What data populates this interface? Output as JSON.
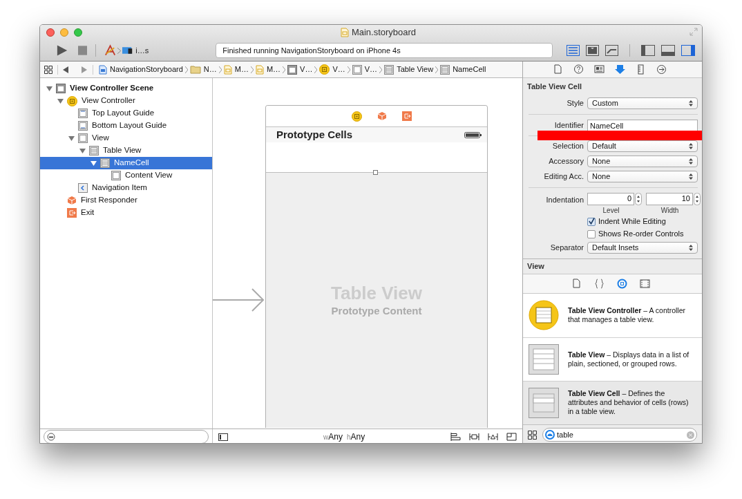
{
  "window": {
    "title": "Main.storyboard"
  },
  "toolbar": {
    "scheme": "i…s",
    "status": "Finished running NavigationStoryboard on iPhone 4s",
    "editor_modes": [
      {
        "selected": true
      },
      {
        "selected": false
      },
      {
        "selected": false
      }
    ],
    "panels": [
      {
        "selected": false
      },
      {
        "selected": false
      },
      {
        "selected": true
      }
    ]
  },
  "jump_bar": [
    {
      "label": "NavigationStoryboard",
      "kind": "project"
    },
    {
      "label": "N…",
      "kind": "folder"
    },
    {
      "label": "M…",
      "kind": "storyboard"
    },
    {
      "label": "M…",
      "kind": "storyboard"
    },
    {
      "label": "V…",
      "kind": "scene"
    },
    {
      "label": "V…",
      "kind": "controller"
    },
    {
      "label": "V…",
      "kind": "view"
    },
    {
      "label": "Table View",
      "kind": "table"
    },
    {
      "label": "NameCell",
      "kind": "table"
    }
  ],
  "outline": [
    {
      "label": "View Controller Scene",
      "kind": "scene",
      "expanded": true,
      "selected": false,
      "children": [
        {
          "label": "View Controller",
          "kind": "controller",
          "expanded": true,
          "selected": false,
          "children": [
            {
              "label": "Top Layout Guide",
              "kind": "guide-top",
              "selected": false
            },
            {
              "label": "Bottom Layout Guide",
              "kind": "guide-bottom",
              "selected": false
            },
            {
              "label": "View",
              "kind": "view",
              "expanded": true,
              "selected": false,
              "children": [
                {
                  "label": "Table View",
                  "kind": "table",
                  "expanded": true,
                  "selected": false,
                  "children": [
                    {
                      "label": "NameCell",
                      "kind": "table",
                      "expanded": true,
                      "selected": true,
                      "children": [
                        {
                          "label": "Content View",
                          "kind": "view",
                          "selected": false
                        }
                      ]
                    }
                  ]
                }
              ]
            },
            {
              "label": "Navigation Item",
              "kind": "nav-item",
              "selected": false
            }
          ]
        },
        {
          "label": "First Responder",
          "kind": "responder",
          "selected": false
        },
        {
          "label": "Exit",
          "kind": "exit",
          "selected": false
        }
      ]
    }
  ],
  "canvas": {
    "scene_title": "Prototype Cells",
    "placeholder_title": "Table View",
    "placeholder_subtitle": "Prototype Content",
    "size_class": {
      "w_label": "w",
      "w": "Any",
      "h_label": "h",
      "h": "Any"
    }
  },
  "inspector": {
    "tabs": [
      {
        "selected": false
      },
      {
        "selected": false
      },
      {
        "selected": false
      },
      {
        "selected": true
      },
      {
        "selected": false
      },
      {
        "selected": false
      }
    ],
    "title": "Table View Cell",
    "groups": [
      [
        {
          "kind": "select",
          "label": "Style",
          "value": "Custom"
        }
      ],
      [
        {
          "kind": "text",
          "label": "Identifier",
          "value": "NameCell"
        }
      ],
      [
        {
          "kind": "select",
          "label": "Selection",
          "value": "Default"
        },
        {
          "kind": "select",
          "label": "Accessory",
          "value": "None"
        },
        {
          "kind": "select",
          "label": "Editing Acc.",
          "value": "None"
        }
      ],
      [
        {
          "kind": "steppers",
          "label": "Indentation",
          "fields": [
            {
              "value": "0",
              "caption": "Level"
            },
            {
              "value": "10",
              "caption": "Width"
            }
          ]
        },
        {
          "kind": "checkbox",
          "label": "Indent While Editing",
          "checked": true
        },
        {
          "kind": "checkbox",
          "label": "Shows Re-order Controls",
          "checked": false
        },
        {
          "kind": "select",
          "label": "Separator",
          "value": "Default Insets"
        }
      ]
    ]
  },
  "library": {
    "title": "View",
    "tabs": [
      {
        "selected": false
      },
      {
        "selected": false
      },
      {
        "selected": true
      },
      {
        "selected": false
      }
    ],
    "items": [
      {
        "text": "**Table View Controller** – A controller that manages a table view.",
        "kind": "controller",
        "selected": false
      },
      {
        "text": "**Table View** – Displays data in a list of plain, sectioned, or grouped rows.",
        "kind": "table",
        "selected": false
      },
      {
        "text": "**Table View Cell** – Defines the attributes and behavior of cells (rows) in a table view.",
        "kind": "cell",
        "selected": true
      }
    ],
    "search": {
      "value": "table"
    }
  }
}
